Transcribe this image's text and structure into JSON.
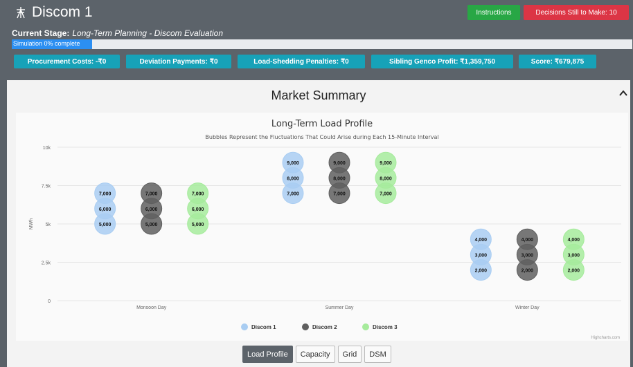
{
  "header": {
    "title": "Discom 1",
    "instructions_label": "Instructions",
    "decisions_label": "Decisions Still to Make: 10"
  },
  "stage": {
    "label": "Current Stage:",
    "value": "Long-Term Planning - Discom Evaluation"
  },
  "progress": {
    "text": "Simulation 0% complete",
    "fraction": 0.13
  },
  "metrics": [
    {
      "label": "Procurement Costs: -₹0"
    },
    {
      "label": "Deviation Payments: ₹0"
    },
    {
      "label": "Load-Shedding Penalties: ₹0"
    },
    {
      "label": "Sibling Genco Profit: ₹1,359,750"
    },
    {
      "label": "Score: ₹679,875"
    }
  ],
  "card": {
    "title": "Market Summary",
    "toggle_icon": "chevron-up-icon"
  },
  "chart_data": {
    "type": "bubble",
    "title": "Long-Term Load Profile",
    "subtitle": "Bubbles Represent the Fluctuations That Could Arise during Each 15-Minute Interval",
    "ylabel": "MWh",
    "ylim": [
      0,
      10000
    ],
    "yticks": [
      "0",
      "2.5k",
      "5k",
      "7.5k",
      "10k"
    ],
    "categories": [
      "Monsoon Day",
      "Summer Day",
      "Winter Day"
    ],
    "series": [
      {
        "name": "Discom 1",
        "color": "#a9cdf2",
        "values": [
          [
            7000,
            6000,
            5000
          ],
          [
            9000,
            8000,
            7000
          ],
          [
            4000,
            3000,
            2000
          ]
        ]
      },
      {
        "name": "Discom 2",
        "color": "#5f5f5f",
        "values": [
          [
            7000,
            6000,
            5000
          ],
          [
            9000,
            8000,
            7000
          ],
          [
            4000,
            3000,
            2000
          ]
        ]
      },
      {
        "name": "Discom 3",
        "color": "#a6eb9c",
        "values": [
          [
            7000,
            6000,
            5000
          ],
          [
            9000,
            8000,
            7000
          ],
          [
            4000,
            3000,
            2000
          ]
        ]
      }
    ],
    "credit": "Highcharts.com"
  },
  "tabs": [
    {
      "label": "Load Profile",
      "active": true
    },
    {
      "label": "Capacity",
      "active": false
    },
    {
      "label": "Grid",
      "active": false
    },
    {
      "label": "DSM",
      "active": false
    }
  ]
}
